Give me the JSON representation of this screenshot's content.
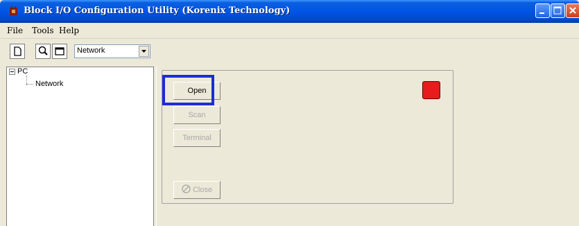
{
  "window": {
    "title": "Block I/O Configuration Utility (Korenix Technology)"
  },
  "menu": {
    "file": "File",
    "tools": "Tools",
    "help": "Help"
  },
  "toolbar": {
    "new_icon": "new-document-icon",
    "search_icon": "search-icon",
    "window_icon": "window-icon",
    "network_select_value": "Network"
  },
  "tree": {
    "root_label": "PC",
    "child_label": "Network"
  },
  "actions": {
    "open_label": "Open",
    "scan_label": "Scan",
    "terminal_label": "Terminal",
    "close_label": "Close"
  },
  "colors": {
    "status_indicator": "#e81c1c",
    "highlight": "#1c2bd6"
  }
}
